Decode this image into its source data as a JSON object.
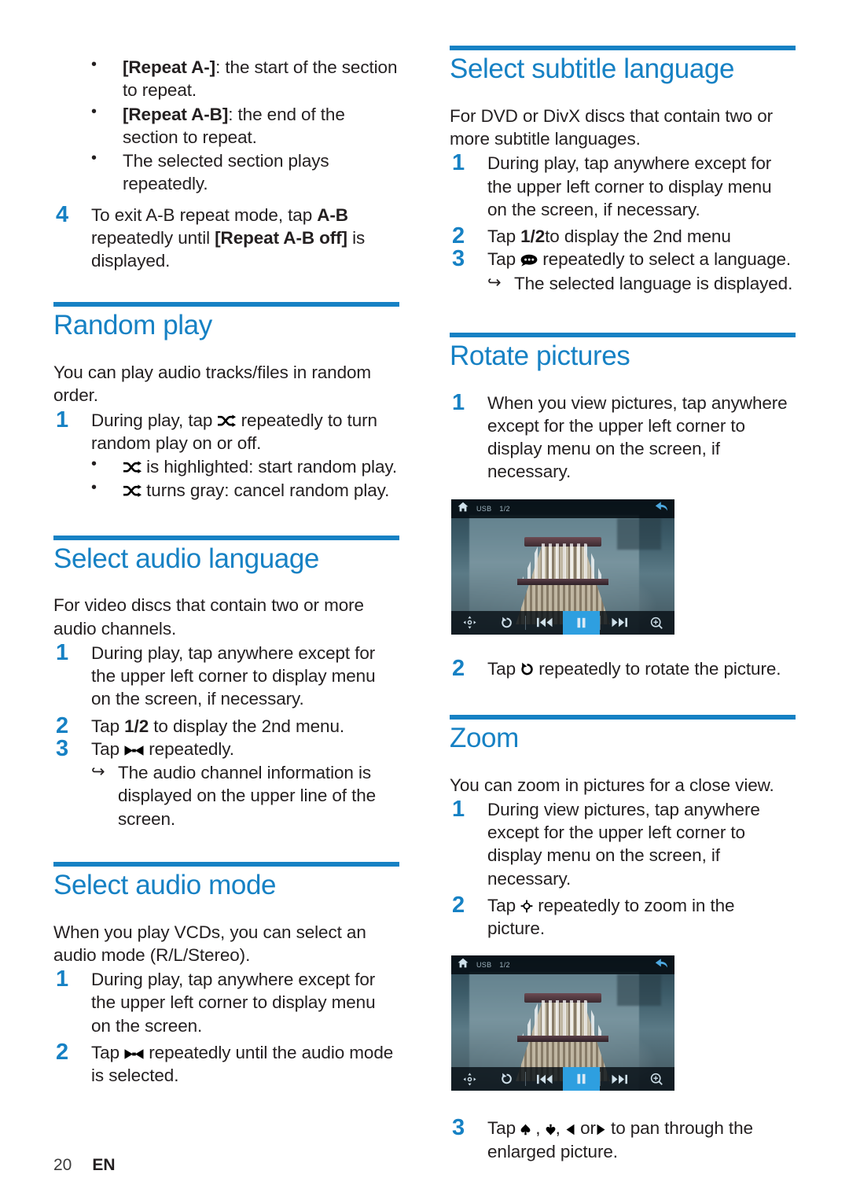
{
  "page": {
    "number": "20",
    "language": "EN"
  },
  "colors": {
    "accent": "#1681c4",
    "text": "#231f20",
    "highlight": "#2e9fe0"
  },
  "left_column": {
    "carryover_bullets": [
      {
        "bold": "[Repeat A-]",
        "rest": ": the start of the section to repeat."
      },
      {
        "bold": "[Repeat A-B]",
        "rest": ": the end of the section to repeat."
      },
      {
        "bold": "",
        "rest": "The selected section plays repeatedly."
      }
    ],
    "carryover_step": {
      "num": "4",
      "part1": "To exit A-B repeat mode, tap ",
      "bold1": "A-B",
      "part2": " repeatedly until ",
      "bold2": "[Repeat A-B off]",
      "part3": " is displayed."
    },
    "sections": [
      {
        "title": "Random play",
        "intro": "You can play audio tracks/files in random order.",
        "steps": [
          {
            "num": "1",
            "part1": "During play, tap ",
            "icon": "shuffle-icon",
            "part2": " repeatedly to turn random play on or off."
          }
        ],
        "bullets": [
          {
            "icon": "shuffle-icon",
            "text": " is highlighted: start random play."
          },
          {
            "icon": "shuffle-icon",
            "text": " turns gray: cancel random play."
          }
        ]
      },
      {
        "title": "Select audio language",
        "intro": "For video discs that contain two or more audio channels.",
        "steps": [
          {
            "num": "1",
            "part1": "During play, tap anywhere except for the upper left corner to display menu on the screen, if necessary.",
            "icon": "",
            "part2": ""
          },
          {
            "num": "2",
            "part1": "Tap ",
            "bold": "1/2",
            "part2": " to display the 2nd menu."
          },
          {
            "num": "3",
            "part1": "Tap ",
            "icon": "audio-channel-icon",
            "part2": " repeatedly."
          }
        ],
        "notes": [
          {
            "glyph": "result-arrow-icon",
            "text": "The audio channel information is displayed on the upper line of the screen."
          }
        ]
      },
      {
        "title": "Select audio mode",
        "intro": "When you play VCDs, you can select an audio mode (R/L/Stereo).",
        "steps": [
          {
            "num": "1",
            "part1": "During play, tap anywhere except for the upper left corner to display menu on the screen.",
            "icon": "",
            "part2": ""
          },
          {
            "num": "2",
            "part1": "Tap ",
            "icon": "audio-channel-icon",
            "part2": " repeatedly until the audio mode is selected."
          }
        ]
      }
    ]
  },
  "right_column": {
    "sections": [
      {
        "title": "Select subtitle language",
        "intro": "For DVD or DivX discs that contain two or more subtitle languages.",
        "steps": [
          {
            "num": "1",
            "part1": "During play, tap anywhere except for the upper left corner to display menu on the screen, if necessary.",
            "icon": "",
            "part2": ""
          },
          {
            "num": "2",
            "part1": "Tap ",
            "bold": "1/2",
            "part2": "to display the 2nd menu"
          },
          {
            "num": "3",
            "part1": "Tap ",
            "icon": "subtitle-icon",
            "part2": " repeatedly to select a language."
          }
        ],
        "notes": [
          {
            "glyph": "result-arrow-icon",
            "text": "The selected language is displayed."
          }
        ]
      },
      {
        "title": "Rotate pictures",
        "intro": "",
        "steps": [
          {
            "num": "1",
            "part1": "When you view pictures, tap anywhere except for the upper left corner to display menu on the screen, if necessary.",
            "icon": "",
            "part2": ""
          },
          {
            "num": "2",
            "part1": "Tap ",
            "icon": "rotate-icon",
            "part2": " repeatedly to rotate the picture."
          }
        ]
      },
      {
        "title": "Zoom",
        "intro": "You can zoom in pictures for a close view.",
        "steps": [
          {
            "num": "1",
            "part1": "During view pictures, tap anywhere except for the upper left corner to display menu on the screen, if necessary.",
            "icon": "",
            "part2": ""
          },
          {
            "num": "2",
            "part1": "Tap ",
            "icon": "zoom-in-icon",
            "part2": " repeatedly to zoom in the picture."
          },
          {
            "num": "3",
            "part1": "Tap ",
            "icon": "pan-arrows-icon",
            "part2": " to pan through the enlarged picture."
          }
        ]
      }
    ]
  },
  "device_screenshot": {
    "topbar": {
      "home_icon": "home-icon",
      "source_label": "USB",
      "index_label": "1/2",
      "back_icon": "back-arrow-icon"
    },
    "controls": [
      {
        "name": "pan-button",
        "icon": "pan-arrows-icon",
        "active": false
      },
      {
        "name": "rotate-button",
        "icon": "rotate-icon",
        "active": false
      },
      {
        "name": "previous-button",
        "icon": "previous-icon",
        "active": false
      },
      {
        "name": "pause-button",
        "icon": "pause-icon",
        "active": true
      },
      {
        "name": "next-button",
        "icon": "next-icon",
        "active": false
      },
      {
        "name": "zoom-button",
        "icon": "zoom-in-icon",
        "active": false
      }
    ]
  },
  "pan_step_text": {
    "tap": "Tap ",
    "sep1": " , ",
    "sep2": ", ",
    "sep3": " or",
    "tail": " to pan through the enlarged picture."
  }
}
